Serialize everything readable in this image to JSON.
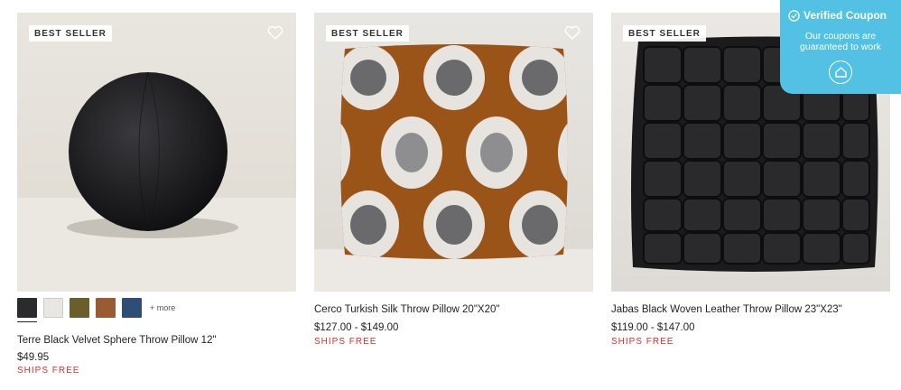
{
  "products": [
    {
      "badge": "BEST SELLER",
      "name": "Terre Black Velvet Sphere Throw Pillow 12\"",
      "price": "$49.95",
      "shipping": "SHIPS FREE",
      "swatches": [
        "#2b2a2d",
        "#e9e7e3",
        "#6b5e2a",
        "#9a5a32",
        "#2e4e78"
      ],
      "more_label": "+ more"
    },
    {
      "badge": "BEST SELLER",
      "name": "Cerco Turkish Silk Throw Pillow 20\"X20\"",
      "price": "$127.00 - $149.00",
      "shipping": "SHIPS FREE"
    },
    {
      "badge": "BEST SELLER",
      "name": "Jabas Black Woven Leather Throw Pillow 23\"X23\"",
      "price": "$119.00 - $147.00",
      "shipping": "SHIPS FREE"
    }
  ],
  "coupon": {
    "title": "Verified Coupon",
    "subtitle": "Our coupons are guaranteed to work"
  },
  "colors": {
    "ships_free": "#d9302c",
    "coupon_bg": "#52c1e3"
  }
}
